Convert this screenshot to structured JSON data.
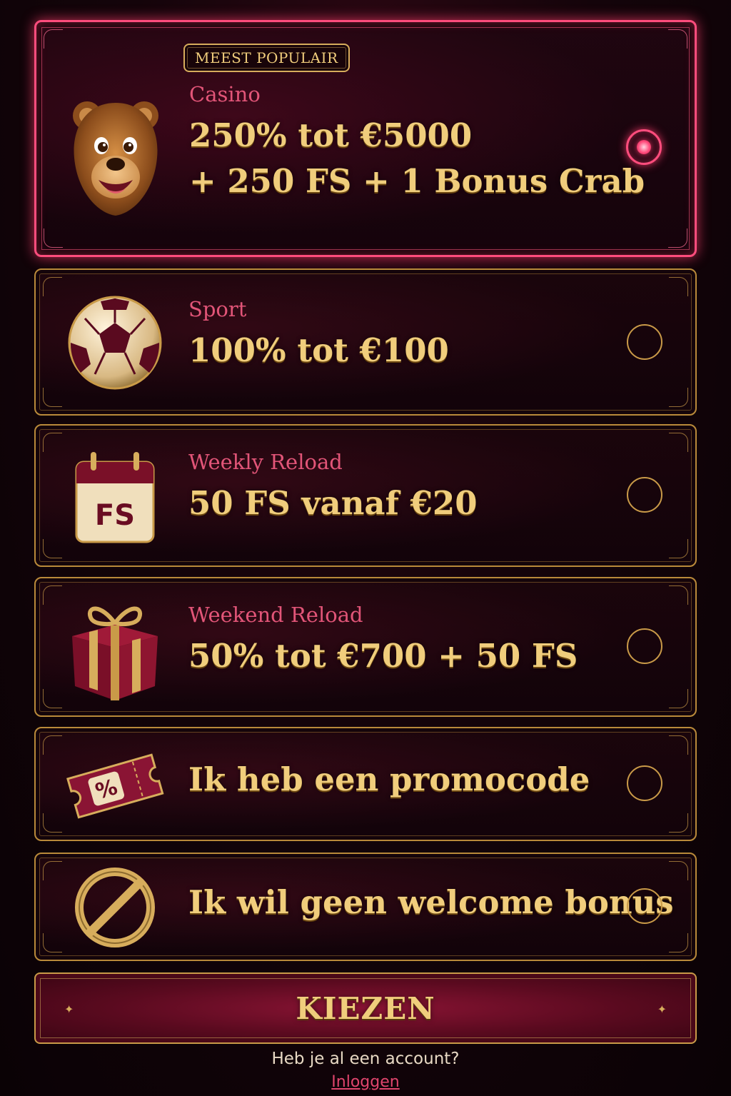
{
  "options": [
    {
      "badge": "MEEST POPULAIR",
      "category": "Casino",
      "offer_line1": "250% tot €5000",
      "offer_line2": "+ 250 FS + 1 Bonus Crab",
      "icon": "bear-icon",
      "selected": true
    },
    {
      "category": "Sport",
      "offer_line1": "100% tot €100",
      "icon": "football-icon",
      "selected": false
    },
    {
      "category": "Weekly Reload",
      "offer_line1": "50 FS vanaf €20",
      "icon": "calendar-icon",
      "icon_text": "FS",
      "selected": false
    },
    {
      "category": "Weekend Reload",
      "offer_line1": "50% tot €700 + 50 FS",
      "icon": "gift-icon",
      "selected": false
    },
    {
      "offer_line1": "Ik heb een promocode",
      "icon": "ticket-icon",
      "icon_text": "%",
      "selected": false
    },
    {
      "offer_line1": "Ik wil geen welcome bonus",
      "icon": "no-entry-icon",
      "selected": false
    }
  ],
  "choose_button": "KIEZEN",
  "footer": {
    "question": "Heb je al een account?",
    "login_link": "Inloggen"
  },
  "colors": {
    "gold": "#f0cd7c",
    "category_pink": "#e25578",
    "selected_glow": "#ff4d7d",
    "button_red": "#8a1434",
    "background": "#14040a"
  }
}
